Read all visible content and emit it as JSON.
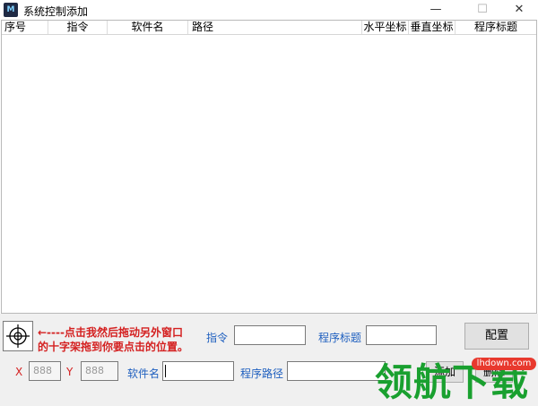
{
  "window": {
    "title": "系统控制添加",
    "icon_label": "M"
  },
  "listview": {
    "columns": [
      "序号",
      "指令",
      "软件名",
      "路径",
      "水平坐标",
      "垂直坐标",
      "程序标题"
    ],
    "rows": []
  },
  "picker": {
    "hint_line1": "←----点击我然后拖动另外窗口",
    "hint_line2": "的十字架拖到你要点击的位置。"
  },
  "form": {
    "command_label": "指令",
    "command_value": "",
    "program_title_label": "程序标题",
    "program_title_value": "",
    "x_label": "X",
    "x_value": "888",
    "y_label": "Y",
    "y_value": "888",
    "software_label": "软件名",
    "software_value": "",
    "path_label": "程序路径",
    "path_value": ""
  },
  "buttons": {
    "config": "配置",
    "add": "添加",
    "delete": "删除"
  },
  "watermark": {
    "site": "lhdown.com",
    "brand": "领航下载"
  },
  "colors": {
    "red": "#d42020",
    "blue": "#1e5fbf",
    "watermark_green": "#19a02f"
  }
}
